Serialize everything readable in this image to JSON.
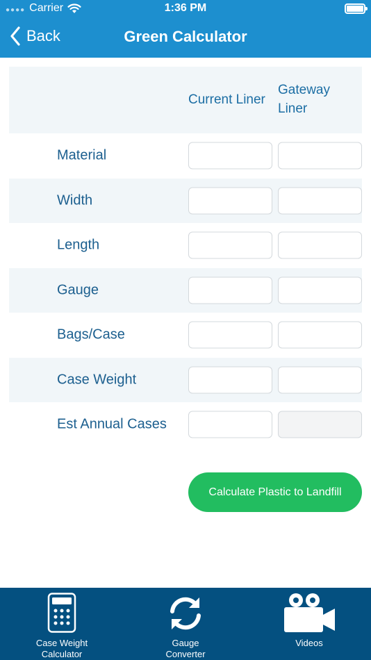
{
  "status_bar": {
    "carrier": "Carrier",
    "time": "1:36 PM"
  },
  "nav": {
    "back_label": "Back",
    "title": "Green Calculator"
  },
  "table": {
    "columns": [
      "Current Liner",
      "Gateway Liner"
    ],
    "rows": [
      {
        "label": "Material"
      },
      {
        "label": "Width"
      },
      {
        "label": "Length"
      },
      {
        "label": "Gauge"
      },
      {
        "label": "Bags/Case"
      },
      {
        "label": "Case Weight"
      },
      {
        "label": "Est Annual Cases"
      }
    ]
  },
  "calculate_button": {
    "label": "Calculate Plastic to Landfill",
    "color": "#22bd60"
  },
  "tabs": [
    {
      "label_line1": "Case Weight",
      "label_line2": "Calculator",
      "icon": "calculator-icon"
    },
    {
      "label_line1": "Gauge",
      "label_line2": "Converter",
      "icon": "refresh-icon"
    },
    {
      "label_line1": "Videos",
      "label_line2": "",
      "icon": "video-camera-icon"
    }
  ],
  "colors": {
    "header": "#1d8fcf",
    "tabbar": "#045080",
    "label_text": "#1c5f8f"
  }
}
